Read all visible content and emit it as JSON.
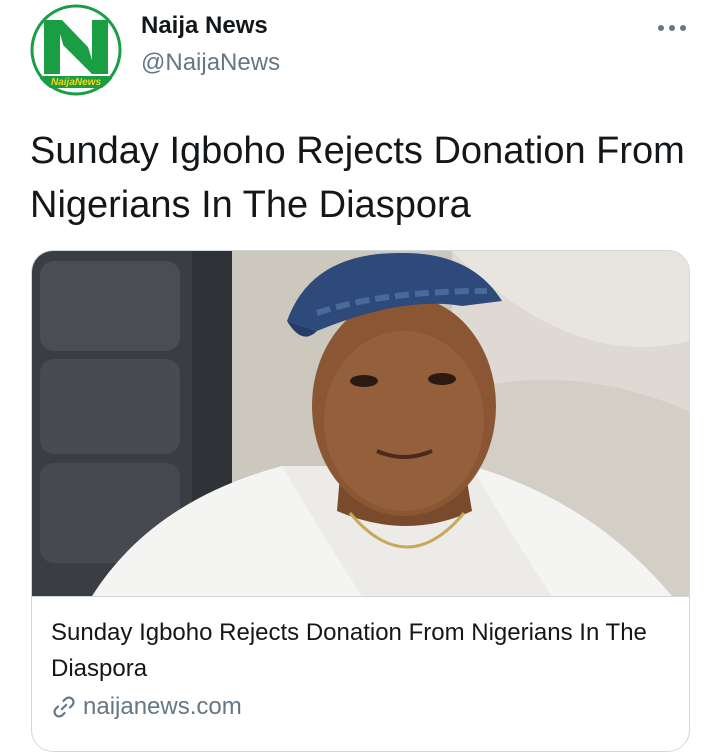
{
  "tweet": {
    "author": {
      "display_name": "Naija News",
      "handle": "@NaijaNews",
      "avatar_icon": "naija-news-logo",
      "avatar_logo_text": "NaijaNews",
      "brand_green": "#1a9e44"
    },
    "more_icon": "more-horizontal-icon",
    "text": "Sunday Igboho Rejects Donation From Nigerians In The Diaspora",
    "card": {
      "image_alt": "photo of a man in a blue cap and white agbada",
      "title": "Sunday Igboho Rejects Donation From Nigerians In The Diaspora",
      "domain": "naijanews.com",
      "domain_icon": "link-icon"
    }
  },
  "colors": {
    "text_primary": "#14171a",
    "text_secondary": "#657786",
    "border": "#cfd9de"
  }
}
